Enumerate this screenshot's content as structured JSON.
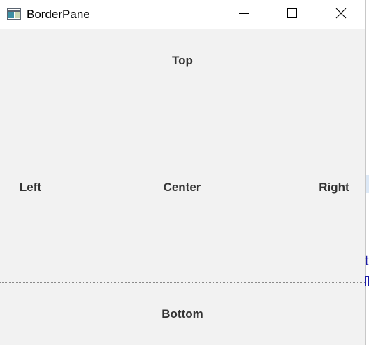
{
  "window": {
    "title": "BorderPane",
    "controls": {
      "minimize_icon": "minimize-icon",
      "maximize_icon": "maximize-icon",
      "close_icon": "close-icon"
    }
  },
  "regions": {
    "top": "Top",
    "left": "Left",
    "center": "Center",
    "right": "Right",
    "bottom": "Bottom"
  },
  "background": {
    "fragment_text": "t"
  },
  "colors": {
    "pane_background": "#f2f2f2",
    "titlebar_background": "#ffffff",
    "divider": "#8a8a8a",
    "label_text": "#333333"
  }
}
